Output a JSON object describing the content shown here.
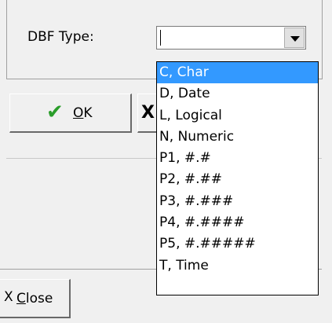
{
  "form": {
    "dbf_type_label": "DBF Type:",
    "dbf_type_value": ""
  },
  "buttons": {
    "ok_label_underlined": "O",
    "ok_label_rest": "K",
    "ok_icon": "checkmark-icon",
    "close_label_underlined": "C",
    "close_label_rest": "lose"
  },
  "dropdown": {
    "selected_index": 0,
    "items": [
      "C, Char",
      "D, Date",
      "L, Logical",
      "N, Numeric",
      "P1, #.#",
      "P2, #.##",
      "P3, #.###",
      "P4, #.####",
      "P5, #.#####",
      "T, Time"
    ]
  },
  "colors": {
    "selection": "#3399ff",
    "check": "#2a9d2a"
  }
}
